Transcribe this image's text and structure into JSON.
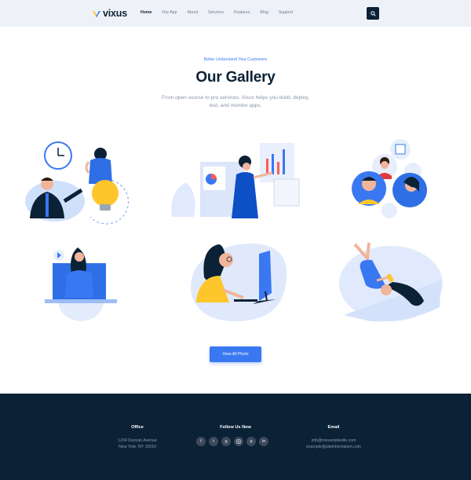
{
  "brand": {
    "name": "vixus"
  },
  "nav": [
    {
      "label": "Home",
      "active": true
    },
    {
      "label": "Our App"
    },
    {
      "label": "About"
    },
    {
      "label": "Services"
    },
    {
      "label": "Features"
    },
    {
      "label": "Blog"
    },
    {
      "label": "Support"
    }
  ],
  "hero": {
    "kicker": "Better Understand Your Customers",
    "title": "Our Gallery",
    "subtitle": "From open source to pro services, Vixus helps you build, deploy, test, and monitor apps."
  },
  "gallery": {
    "items": [
      "clock-lightbulb-illustration",
      "presentation-chart-illustration",
      "team-chat-illustration",
      "laptop-video-illustration",
      "computer-work-illustration",
      "phone-relax-illustration"
    ],
    "button_label": "View All Photo"
  },
  "footer": {
    "office": {
      "heading": "Office",
      "line1": "1234 Duncan Avenue",
      "line2": "New York, NY 10010"
    },
    "follow": {
      "heading": "Follow Us Now",
      "icons": [
        "facebook-icon",
        "twitter-icon",
        "google-plus-icon",
        "instagram-icon",
        "pinterest-icon",
        "linkedin-icon"
      ]
    },
    "email": {
      "heading": "Email",
      "line1": "info@mexamplesite.com",
      "line2": "example@siteinformation.com"
    }
  },
  "colors": {
    "navy": "#0b2136",
    "accent": "#3a78f2",
    "header_bg": "#eef2f8",
    "yellow": "#ffc62b"
  }
}
